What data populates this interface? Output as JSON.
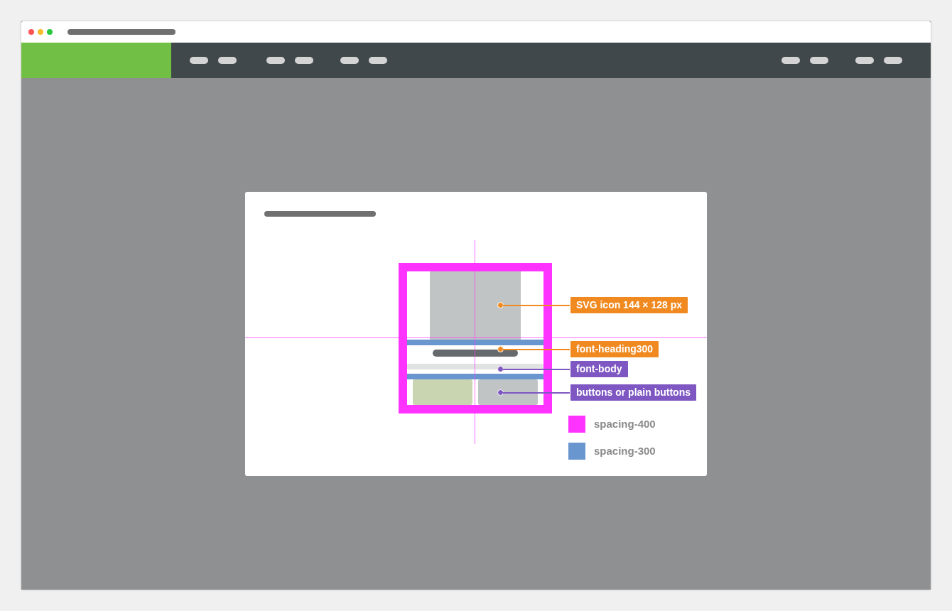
{
  "annotations": [
    {
      "label": "SVG icon 144 × 128 px",
      "color": "#f0891f"
    },
    {
      "label": "font-heading300",
      "color": "#f0891f"
    },
    {
      "label": "font-body",
      "color": "#7e57c2"
    },
    {
      "label": "buttons or plain buttons",
      "color": "#7e57c2"
    }
  ],
  "legend": [
    {
      "label": "spacing-400",
      "color": "#ff33ff"
    },
    {
      "label": "spacing-300",
      "color": "#6a96cf"
    }
  ]
}
